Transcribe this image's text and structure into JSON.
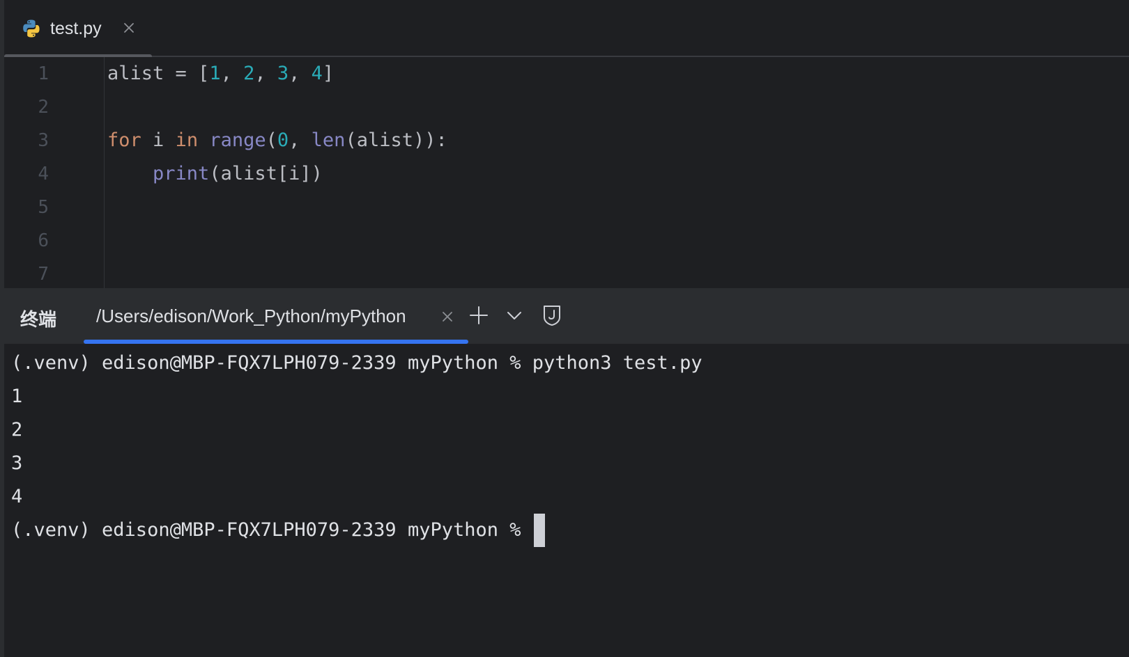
{
  "editor": {
    "tab": {
      "label": "test.py",
      "icon": "python-file-icon"
    },
    "line_numbers": [
      "1",
      "2",
      "3",
      "4",
      "5",
      "6",
      "7"
    ],
    "code": {
      "l1": {
        "name": "alist",
        "op": " = [",
        "n1": "1",
        "c1": ", ",
        "n2": "2",
        "c2": ", ",
        "n3": "3",
        "c3": ", ",
        "n4": "4",
        "end": "]"
      },
      "l3": {
        "for": "for",
        "sp1": " i ",
        "in": "in",
        "sp2": " ",
        "range": "range",
        "open": "(",
        "zero": "0",
        "comma": ", ",
        "len": "len",
        "rest": "(alist)):"
      },
      "l4": {
        "indent": "    ",
        "print": "print",
        "rest": "(alist[i])"
      }
    }
  },
  "terminal": {
    "title": "终端",
    "tab_label": "/Users/edison/Work_Python/myPython",
    "lines": [
      "(.venv) edison@MBP-FQX7LPH079-2339 myPython % python3 test.py",
      "1",
      "2",
      "3",
      "4",
      "(.venv) edison@MBP-FQX7LPH079-2339 myPython % "
    ]
  },
  "colors": {
    "background": "#1e1f22",
    "panel": "#2b2d30",
    "accent": "#3574f0",
    "keyword": "#cf8e6d",
    "number": "#2aacb8",
    "builtin": "#8888c6"
  }
}
